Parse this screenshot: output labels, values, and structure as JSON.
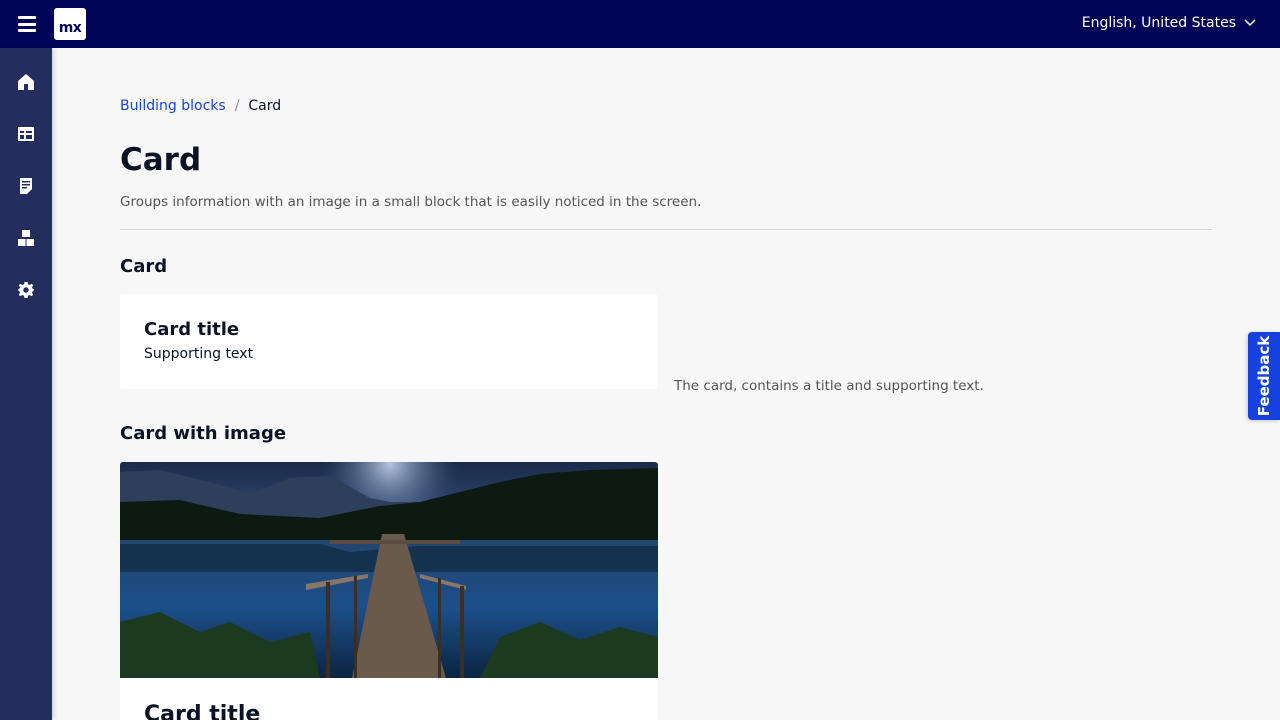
{
  "header": {
    "logo_text": "mx",
    "language": "English, United States"
  },
  "sidebar": {
    "items": [
      {
        "icon": "home-icon"
      },
      {
        "icon": "table-icon"
      },
      {
        "icon": "document-icon"
      },
      {
        "icon": "building-blocks-icon"
      },
      {
        "icon": "gear-icon"
      }
    ]
  },
  "breadcrumb": {
    "parent": "Building blocks",
    "separator": "/",
    "current": "Card"
  },
  "page": {
    "title": "Card",
    "description": "Groups information with an image in a small block that is easily noticed in the screen."
  },
  "sections": [
    {
      "title": "Card",
      "card_title": "Card title",
      "card_text": "Supporting text",
      "description": "The card, contains a title and supporting text."
    },
    {
      "title": "Card with image",
      "card_title": "Card title",
      "image": "lake-pier-night-image"
    }
  ],
  "feedback": {
    "label": "Feedback"
  },
  "colors": {
    "topbar": "#020557",
    "sidebar": "#252c5e",
    "link": "#1741de",
    "feedback": "#1741de"
  }
}
